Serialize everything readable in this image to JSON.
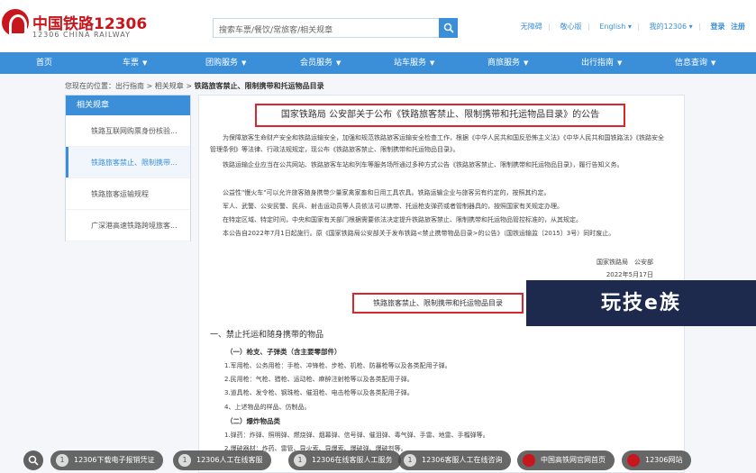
{
  "header": {
    "logo_cn": "中国铁路12306",
    "logo_en": "12306 CHINA RAILWAY",
    "search_placeholder": "搜索车票/餐饮/常旅客/相关规章",
    "links": [
      "无障碍",
      "敬心版",
      "English ▾",
      "我的12306 ▾"
    ],
    "login": "登录",
    "register": "注册",
    "brand_color": "#c8161d",
    "accent_color": "#3b8fd9"
  },
  "nav": {
    "items": [
      "首页",
      "车票",
      "团购服务",
      "会员服务",
      "站车服务",
      "商旅服务",
      "出行指南",
      "信息查询"
    ]
  },
  "breadcrumb": {
    "prefix": "您现在的位置：出行指南 > 相关规章 >",
    "current": "铁路旅客禁止、限制携带和托运物品目录"
  },
  "sidebar": {
    "title": "相关规章",
    "items": [
      "铁路互联网购票身份核验...",
      "铁路旅客禁止、限制携带...",
      "铁路旅客运输规程",
      "广深港高速铁路跨境旅客..."
    ]
  },
  "content": {
    "title": "国家铁路局 公安部关于公布《铁路旅客禁止、限制携带和托运物品目录》的公告",
    "paragraphs": [
      "为保障旅客生命财产安全和铁路运输安全，加强和规范铁路旅客运输安全检查工作，根据《中华人民共和国反恐怖主义法》《中华人民共和国铁路法》《铁路安全管理条例》等法律、行政法规规定，现公布《铁路旅客禁止、限制携带和托运物品目录》。",
      "铁路运输企业应当在公共网站、铁路旅客车站和列车等服务场所通过多种方式公告《铁路旅客禁止、限制携带和托运物品目录》，履行告知义务。",
      "公益性\"慢火车\"可以允许旅客随身携带少量家禽家畜和日用工具农具。铁路运输企业与旅客另有约定的，按照其约定。",
      "军人、武警、公安民警、民兵、射击运动员等人员依法可以携带、托运枪支弹药或者管制器具的，按照国家有关规定办理。",
      "在特定区域、特定时间，中央和国家有关部门根据需要依法决定提升铁路旅客禁止、限制携带和托运物品管控标准的，从其规定。",
      "本公告自2022年7月1日起施行。原《国家铁路局公安部关于发布铁路<禁止携带物品目录>的公告》（国铁运输监〔2015〕3号）同时废止。"
    ],
    "sign_org": "国家铁路局　公安部",
    "sign_date": "2022年5月17日",
    "list_title": "铁路旅客禁止、限制携带和托运物品目录",
    "section_head": "一、禁止托运和随身携带的物品",
    "sub1": "（一）枪支、子弹类（含主要零部件）",
    "items1": [
      "1.军用枪、公务用枪：手枪、冲锋枪、步枪、机枪、防暴枪等以及各类配用子弹。",
      "2.民用枪：气枪、猎枪、运动枪、麻醉注射枪等以及各类配用子弹。",
      "3.道具枪、发令枪、钢珠枪、催泪枪、电击枪等以及各类配用子弹。",
      "4、上述物品的样品、仿制品。"
    ],
    "sub2": "（二）爆炸物品类",
    "items2": [
      "1.弹药：炸弹、照明弹、燃烧弹、烟幕弹、信号弹、催泪弹、毒气弹、手雷、地雷、手榴弹等。",
      "2.爆破器材：炸药、雷管、导火索、导爆索、爆破弹、爆破剂等。"
    ]
  },
  "watermark": "玩技e族",
  "bottom_bar": {
    "pills": [
      {
        "num": "1",
        "label": "12306下载电子报销凭证"
      },
      {
        "num": "1",
        "label": "12306人工在线客服"
      },
      {
        "num": "1",
        "label": "12306在线客服人工服务"
      },
      {
        "num": "1",
        "label": "12306客服人工在线咨询"
      },
      {
        "num": "",
        "label": "中国高铁网官网首页"
      },
      {
        "num": "",
        "label": "12306网站"
      }
    ]
  }
}
